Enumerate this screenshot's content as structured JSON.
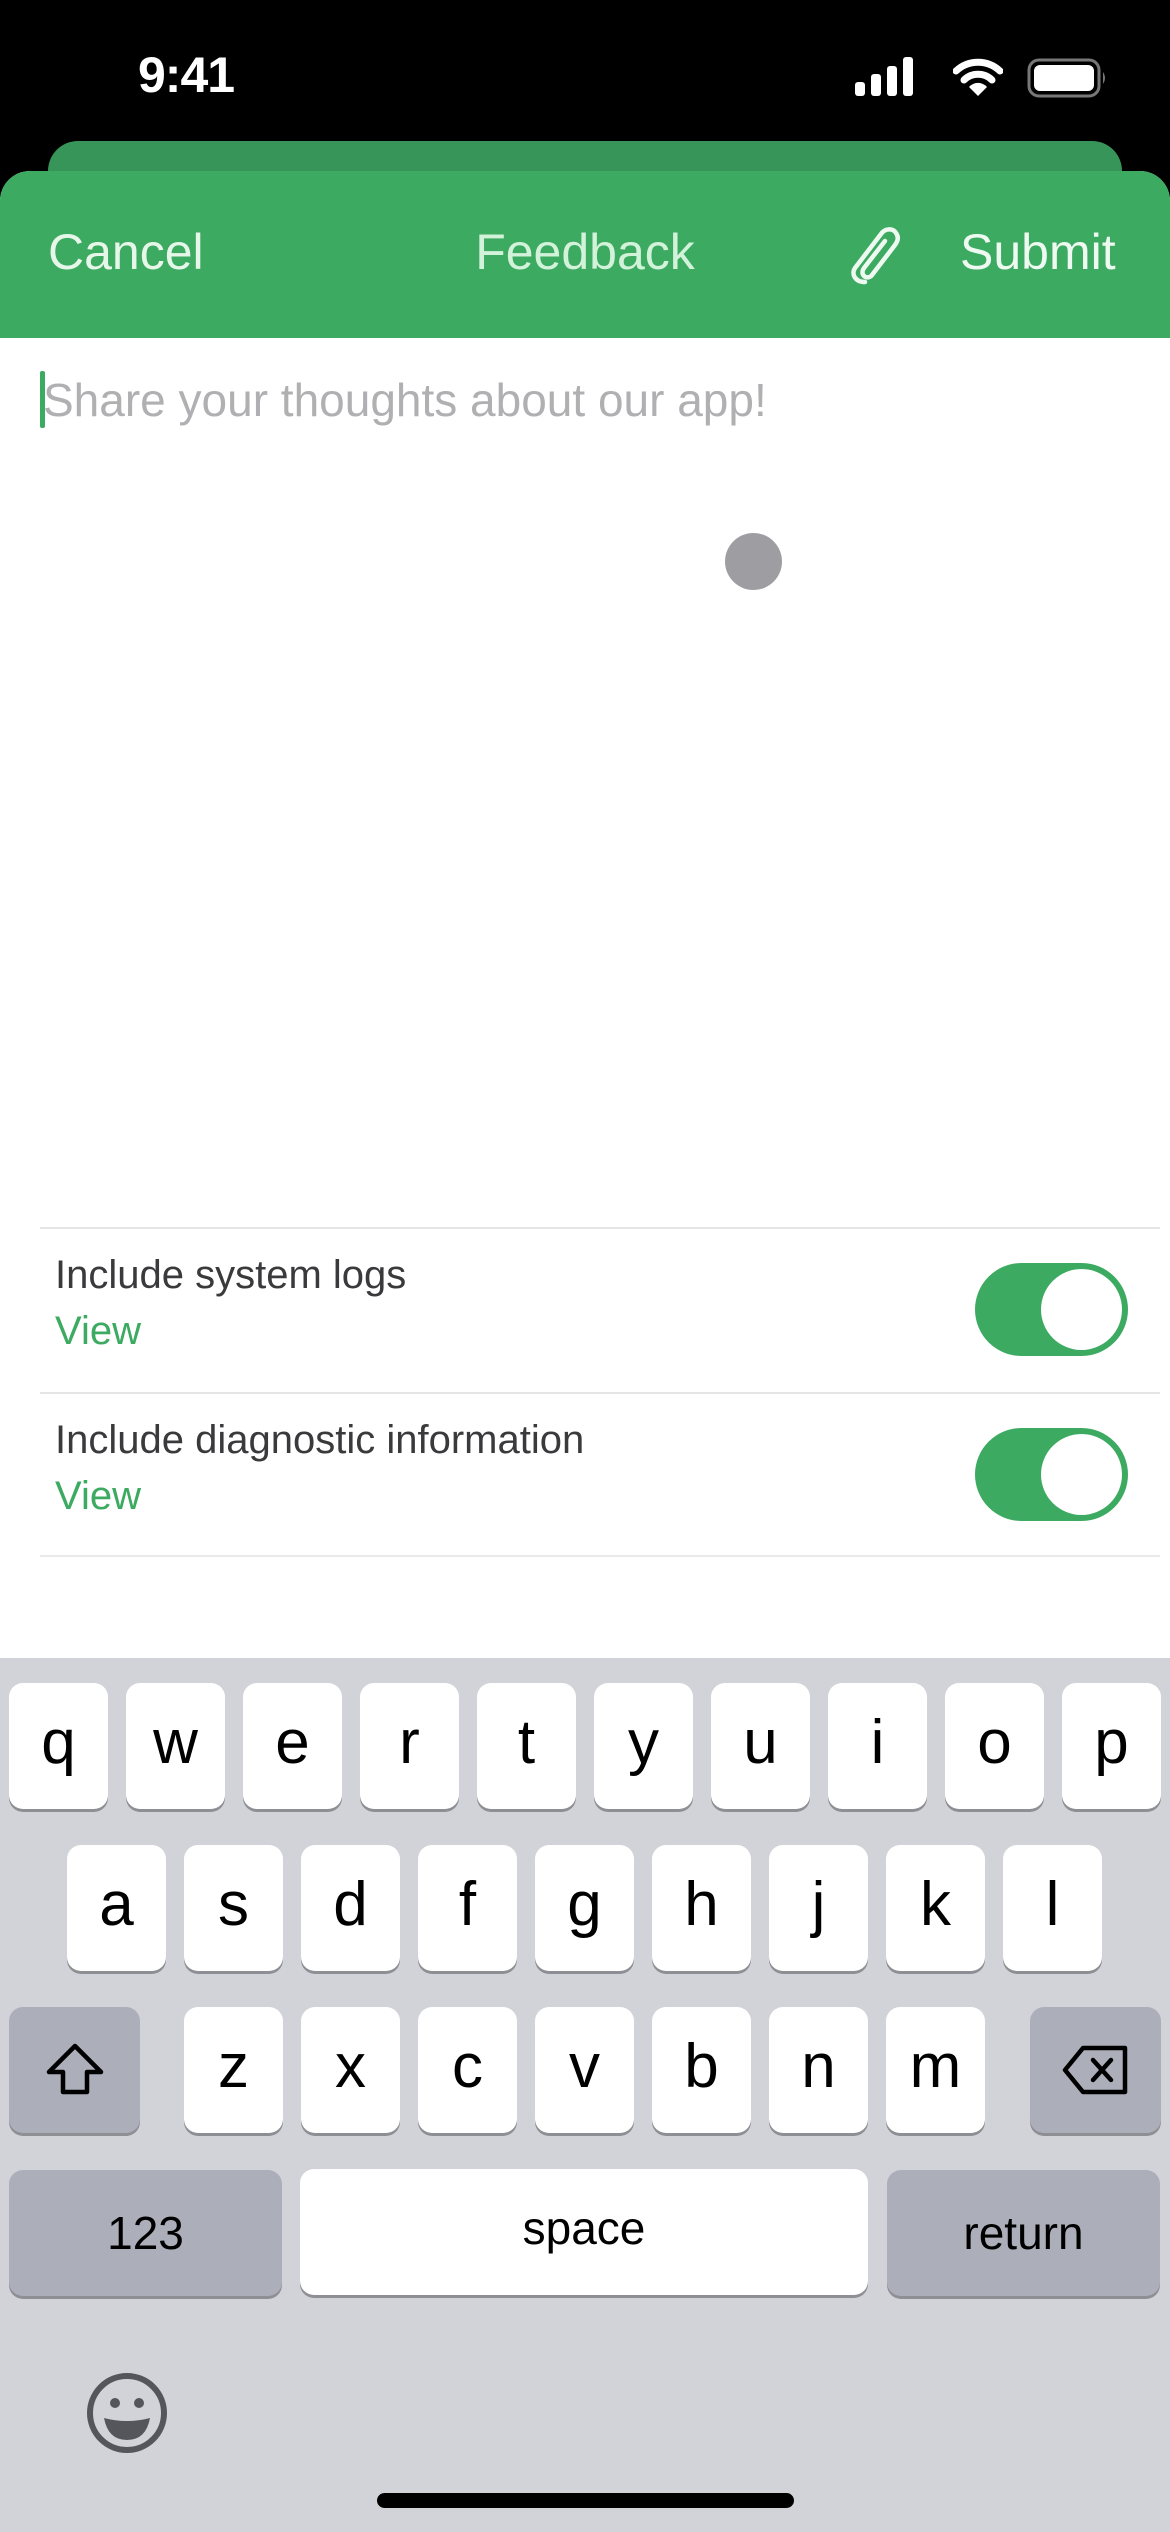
{
  "status_bar": {
    "time": "9:41",
    "icons": [
      "cellular-signal-icon",
      "wifi-icon",
      "battery-icon"
    ]
  },
  "nav": {
    "cancel_label": "Cancel",
    "title": "Feedback",
    "attach_icon": "paperclip-icon",
    "submit_label": "Submit"
  },
  "feedback": {
    "value": "",
    "placeholder": "Share your thoughts about our app!"
  },
  "options": [
    {
      "label": "Include system logs",
      "link": "View",
      "enabled": true
    },
    {
      "label": "Include diagnostic information",
      "link": "View",
      "enabled": true
    }
  ],
  "keyboard": {
    "row1": [
      "q",
      "w",
      "e",
      "r",
      "t",
      "y",
      "u",
      "i",
      "o",
      "p"
    ],
    "row2": [
      "a",
      "s",
      "d",
      "f",
      "g",
      "h",
      "j",
      "k",
      "l"
    ],
    "row3": [
      "z",
      "x",
      "c",
      "v",
      "b",
      "n",
      "m"
    ],
    "shift_icon": "shift-icon",
    "backspace_icon": "backspace-icon",
    "numbers_label": "123",
    "space_label": "space",
    "return_label": "return",
    "emoji_icon": "emoji-icon"
  },
  "colors": {
    "accent": "#3caa60",
    "accent_dark": "#38955a",
    "keyboard_bg": "#d2d3d8",
    "function_key": "#acafba"
  }
}
